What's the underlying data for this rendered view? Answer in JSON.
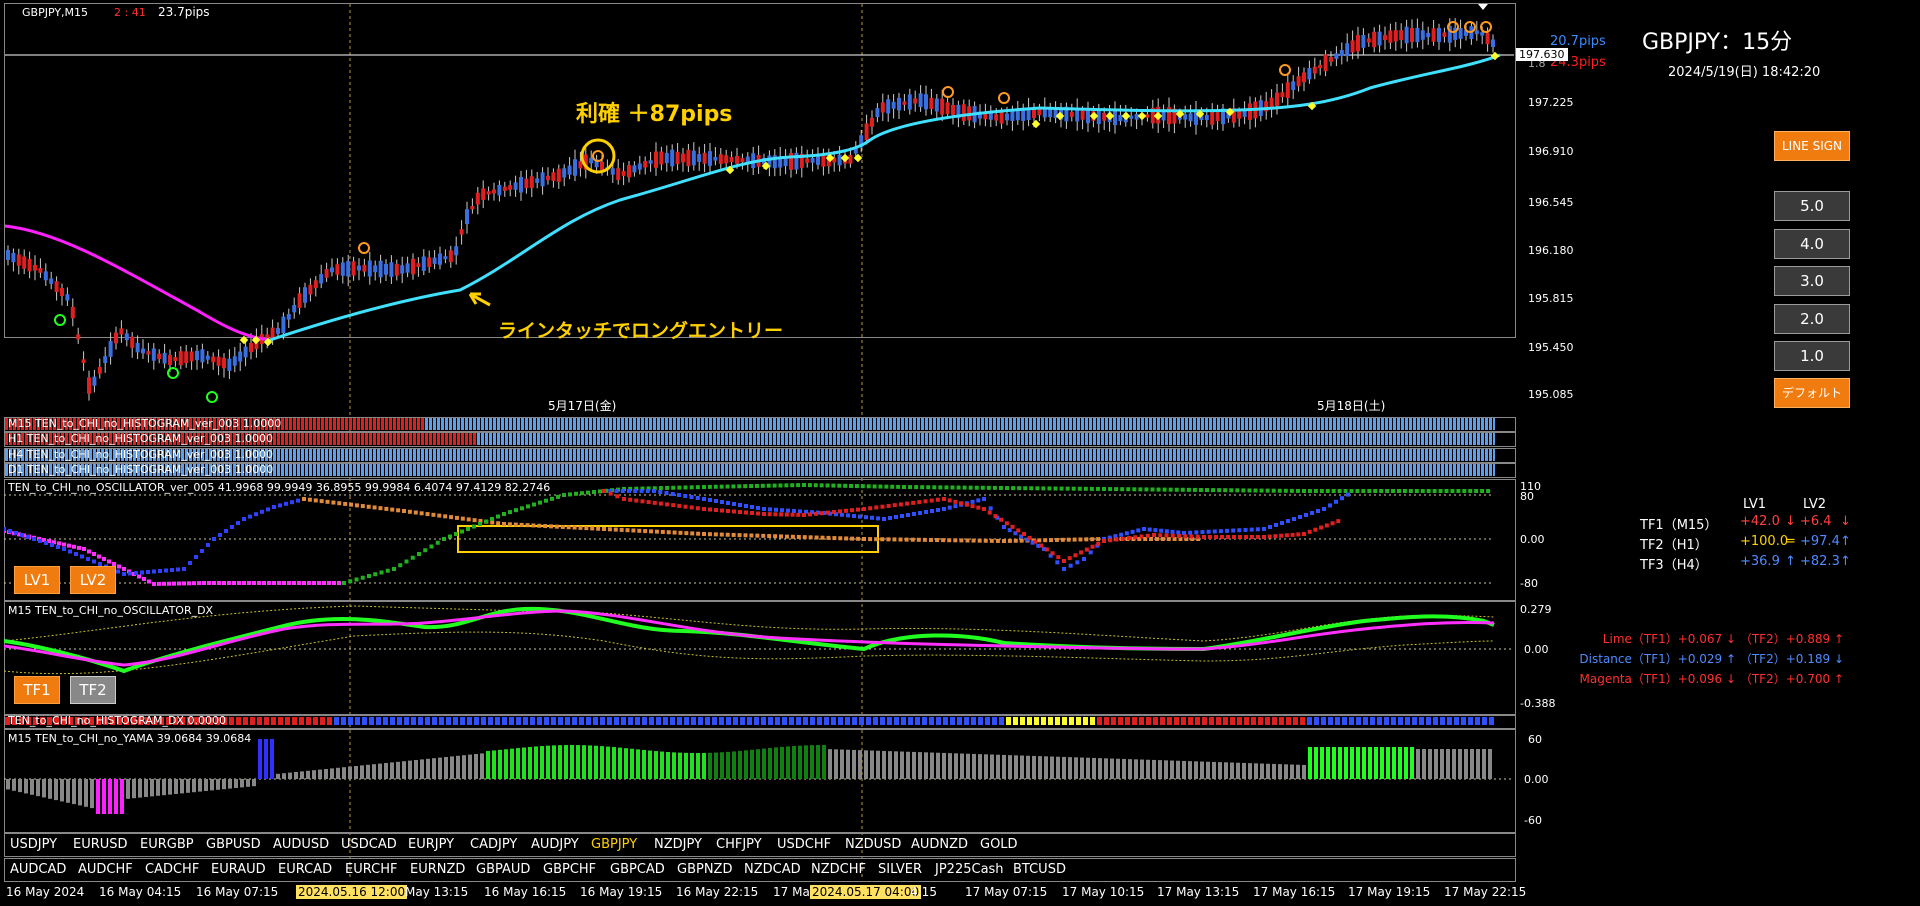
{
  "header": {
    "symbol_tf": "GBPJPY,M15",
    "countdown": "2 : 41",
    "spread_pips": "23.7pips",
    "title_jp": "GBPJPY：15分",
    "datetime": "2024/5/19(日) 18:42:20",
    "pips_blue": "20.7pips",
    "pips_red_prefix": "1.8",
    "pips_red": "24.3pips",
    "current_price": "197.630"
  },
  "price_axis": [
    "197.225",
    "196.910",
    "196.545",
    "196.180",
    "195.815",
    "195.450",
    "195.085"
  ],
  "annotations": {
    "take_profit": "利確 ＋87pips",
    "entry_note": "ラインタッチでロングエントリー"
  },
  "day_labels": [
    "5月17日(金)",
    "5月18日(土)"
  ],
  "buttons": {
    "line_sign": "LINE SIGN",
    "levels": [
      "5.0",
      "4.0",
      "3.0",
      "2.0",
      "1.0"
    ],
    "default": "デフォルト",
    "lv1": "LV1",
    "lv2": "LV2",
    "tf1": "TF1",
    "tf2": "TF2"
  },
  "histograms": [
    "M15 TEN_to_CHI_no_HISTOGRAM_ver_003 1.0000",
    "H1 TEN_to_CHI_no_HISTOGRAM_ver_003 1.0000",
    "H4 TEN_to_CHI_no_HISTOGRAM_ver_003 1.0000",
    "D1 TEN_to_CHI_no_HISTOGRAM_ver_003 1.0000"
  ],
  "oscillator": {
    "title": "TEN_to_CHI_no_OSCILLATOR_ver_005 41.9968 99.9949 36.8955 99.9984 6.4074 97.4129 82.2746",
    "axis": [
      "110",
      "80",
      "0.00",
      "-80"
    ],
    "col_lv1": "LV1",
    "col_lv2": "LV2",
    "rows": [
      {
        "label": "TF1（M15）",
        "v1": "+42.0",
        "a1": "↓",
        "v2": "+6.4",
        "a2": "↓",
        "c1": "#ff4040",
        "c2": "#ff4040"
      },
      {
        "label": "TF2（H1）",
        "v1": "+100.0",
        "a1": "=",
        "v2": "+97.4",
        "a2": "↑",
        "c1": "#ffd000",
        "c2": "#4f8bff"
      },
      {
        "label": "TF3（H4）",
        "v1": "+36.9",
        "a1": "↑",
        "v2": "+82.3",
        "a2": "↑",
        "c1": "#4f8bff",
        "c2": "#4f8bff"
      }
    ]
  },
  "dx": {
    "title": "M15 TEN_to_CHI_no_OSCILLATOR_DX",
    "axis": [
      "0.279",
      "0.00",
      "-0.388"
    ],
    "rows": [
      {
        "text": "Lime（TF1）+0.067 ↓ （TF2）+0.889 ↑",
        "color": "#ff3030"
      },
      {
        "text": "Distance（TF1）+0.029 ↑ （TF2）+0.189 ↓",
        "color": "#4f8bff"
      },
      {
        "text": "Magenta（TF1）+0.096 ↓ （TF2）+0.700 ↑",
        "color": "#ff3030"
      }
    ]
  },
  "hist_dx": {
    "title": "TEN_to_CHI_no_HISTOGRAM_DX 0.0000"
  },
  "yama": {
    "title": "M15  TEN_to_CHI_no_YAMA  39.0684 39.0684",
    "axis": [
      "60",
      "0.00",
      "-60"
    ]
  },
  "symbols_row1": [
    "USDJPY",
    "EURUSD",
    "EURGBP",
    "GBPUSD",
    "AUDUSD",
    "USDCAD",
    "EURJPY",
    "CADJPY",
    "AUDJPY",
    "GBPJPY",
    "NZDJPY",
    "CHFJPY",
    "USDCHF",
    "NZDUSD",
    "AUDNZD",
    "GOLD"
  ],
  "symbols_row1_active": "GBPJPY",
  "symbols_row2": [
    "AUDCAD",
    "AUDCHF",
    "CADCHF",
    "EURAUD",
    "EURCAD",
    "EURCHF",
    "EURNZD",
    "GBPAUD",
    "GBPCHF",
    "GBPCAD",
    "GBPNZD",
    "NZDCAD",
    "NZDCHF",
    "SILVER",
    "JP225Cash",
    "BTCUSD"
  ],
  "time_axis": [
    "16 May 2024",
    "16 May 04:15",
    "16 May 07:15",
    "2024.05.16 12:00",
    "May 13:15",
    "16 May 16:15",
    "16 May 19:15",
    "16 May 22:15",
    "17 Ma",
    "2024.05.17 04:00",
    "4:15",
    "17 May 07:15",
    "17 May 10:15",
    "17 May 13:15",
    "17 May 16:15",
    "17 May 19:15",
    "17 May 22:15"
  ],
  "colors": {
    "ema": "#40e0ff",
    "ema_old": "#ff20ff",
    "bull": "#3a6fe0",
    "bear": "#e02020",
    "hist_blue": "#5aa0f0",
    "hist_red": "#e02020",
    "lime": "#20ff20",
    "accent": "#f07c10"
  }
}
